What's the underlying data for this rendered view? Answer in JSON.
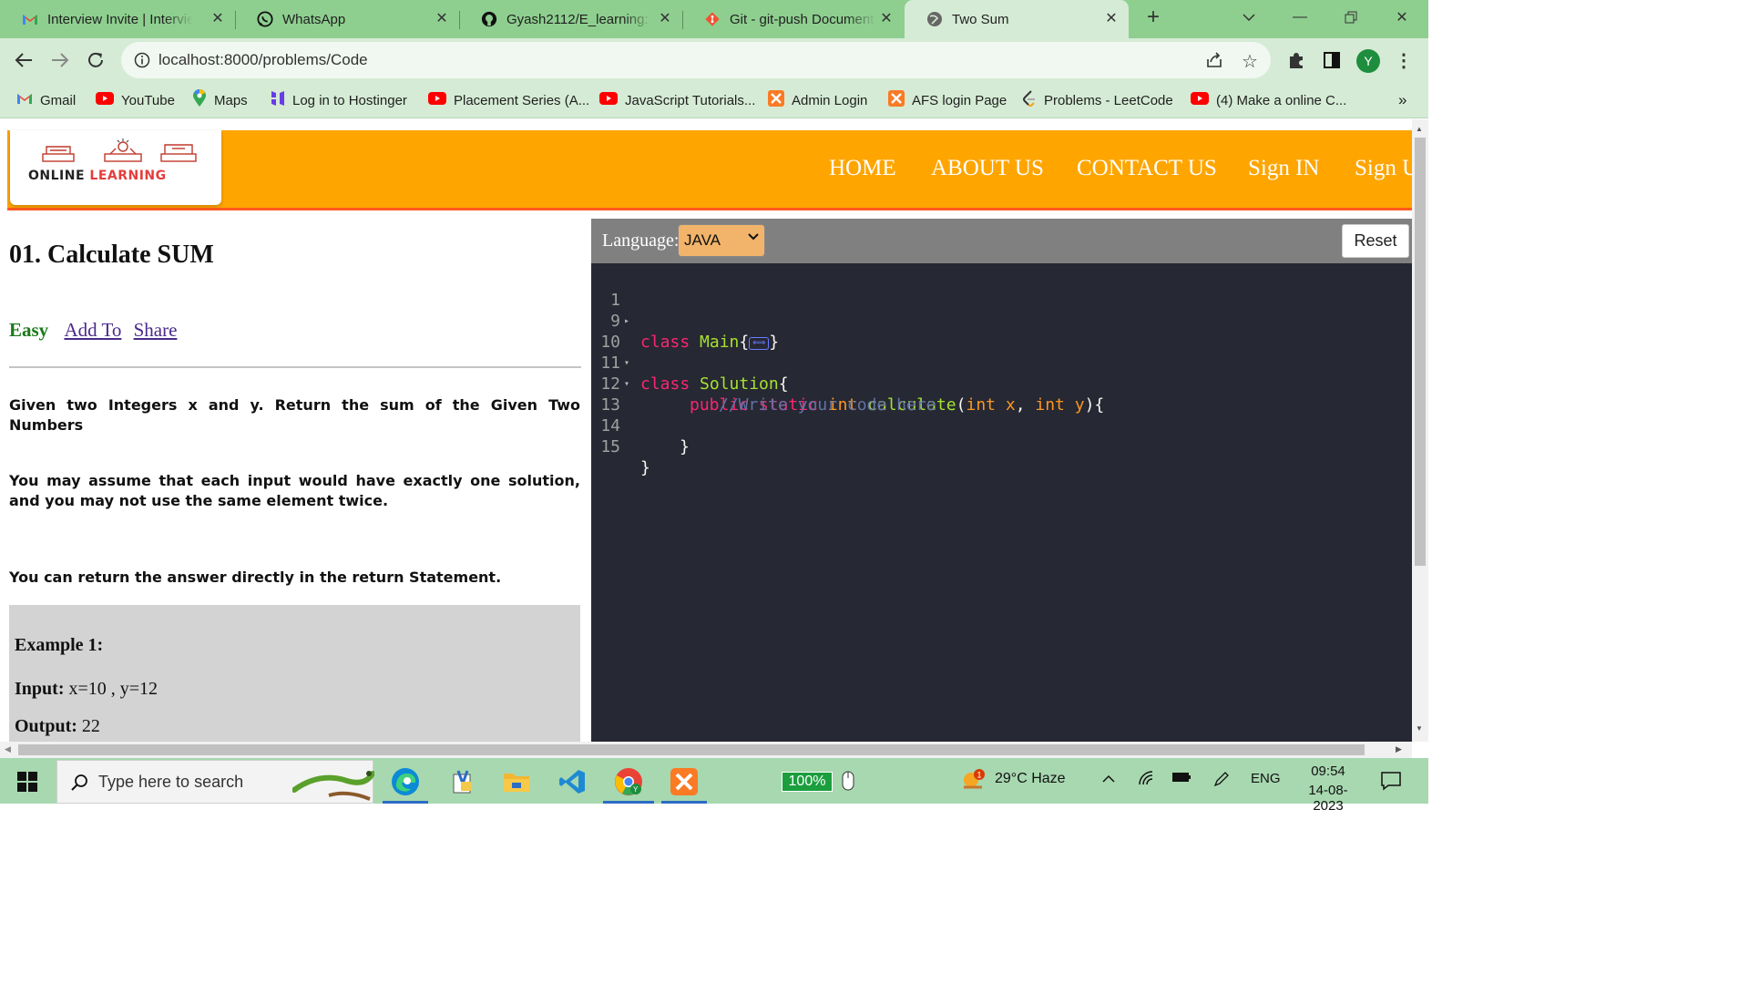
{
  "browser": {
    "tabs": [
      {
        "title": "Interview Invite | Interview",
        "icon": "gmail-icon"
      },
      {
        "title": "WhatsApp",
        "icon": "whatsapp-icon"
      },
      {
        "title": "Gyash2112/E_learning: Ar",
        "icon": "github-icon"
      },
      {
        "title": "Git - git-push Documenta",
        "icon": "git-icon"
      },
      {
        "title": "Two Sum",
        "icon": "globe-icon",
        "active": true
      }
    ],
    "url": "localhost:8000/problems/Code",
    "profile_initial": "Y",
    "bookmarks": [
      {
        "label": "Gmail",
        "icon": "gmail-icon"
      },
      {
        "label": "YouTube",
        "icon": "youtube-icon"
      },
      {
        "label": "Maps",
        "icon": "maps-icon"
      },
      {
        "label": "Log in to Hostinger",
        "icon": "hostinger-icon"
      },
      {
        "label": "Placement Series (A...",
        "icon": "youtube-icon"
      },
      {
        "label": "JavaScript Tutorials...",
        "icon": "youtube-icon"
      },
      {
        "label": "Admin Login",
        "icon": "xampp-icon"
      },
      {
        "label": "AFS login Page",
        "icon": "xampp-icon"
      },
      {
        "label": "Problems - LeetCode",
        "icon": "leetcode-icon"
      },
      {
        "label": "(4) Make a online C...",
        "icon": "youtube-icon"
      }
    ],
    "bookmarks_overflow": "»"
  },
  "site": {
    "logo": {
      "line1": "ONLINE ",
      "line2": "LEARNING"
    },
    "nav": [
      "HOME",
      "ABOUT US",
      "CONTACT US",
      "Sign IN",
      "Sign U"
    ]
  },
  "problem": {
    "title": "01. Calculate SUM",
    "difficulty": "Easy",
    "add_to": "Add To",
    "share": "Share",
    "paragraphs": [
      "Given two Integers x and y. Return the sum of the Given Two Numbers",
      "You may assume that each input would have exactly one solution, and you may not use the same element twice.",
      "You can return the answer directly in the return Statement."
    ],
    "example": {
      "heading": "Example 1:",
      "input_label": "Input:",
      "input_value": " x=10 , y=12",
      "output_label": "Output:",
      "output_value": " 22"
    }
  },
  "editor": {
    "language_label": "Language:",
    "language": "JAVA",
    "reset_label": "Reset",
    "folded_marker": "⟺",
    "lines": [
      {
        "num": "1",
        "fold": "▸"
      },
      {
        "num": "9",
        "fold": ""
      },
      {
        "num": "10",
        "fold": "▾"
      },
      {
        "num": "11",
        "fold": "▾"
      },
      {
        "num": "12",
        "fold": ""
      },
      {
        "num": "13",
        "fold": ""
      },
      {
        "num": "14",
        "fold": ""
      },
      {
        "num": "15",
        "fold": ""
      }
    ],
    "code": {
      "l1_kw": "class",
      "l1_name": "Main",
      "l1_open": "{",
      "l1_close": "}",
      "l10_kw": "class",
      "l10_name": "Solution",
      "l10_open": "{",
      "l11_mods": "public static",
      "l11_type": "int",
      "l11_fn": "calculate",
      "l11_open": "(",
      "l11_t1": "int",
      "l11_p1": "x",
      "l11_sep": ", ",
      "l11_t2": "int",
      "l11_p2": "y",
      "l11_close": "){",
      "l12_comment": "//Write your code here",
      "l14_brace": "}",
      "l15_brace": "}"
    }
  },
  "taskbar": {
    "search_placeholder": "Type here to search",
    "zoom": "100%",
    "weather": "29°C  Haze",
    "language": "ENG",
    "time": "09:54",
    "date": "14-08-2023",
    "weather_badge": "1"
  }
}
